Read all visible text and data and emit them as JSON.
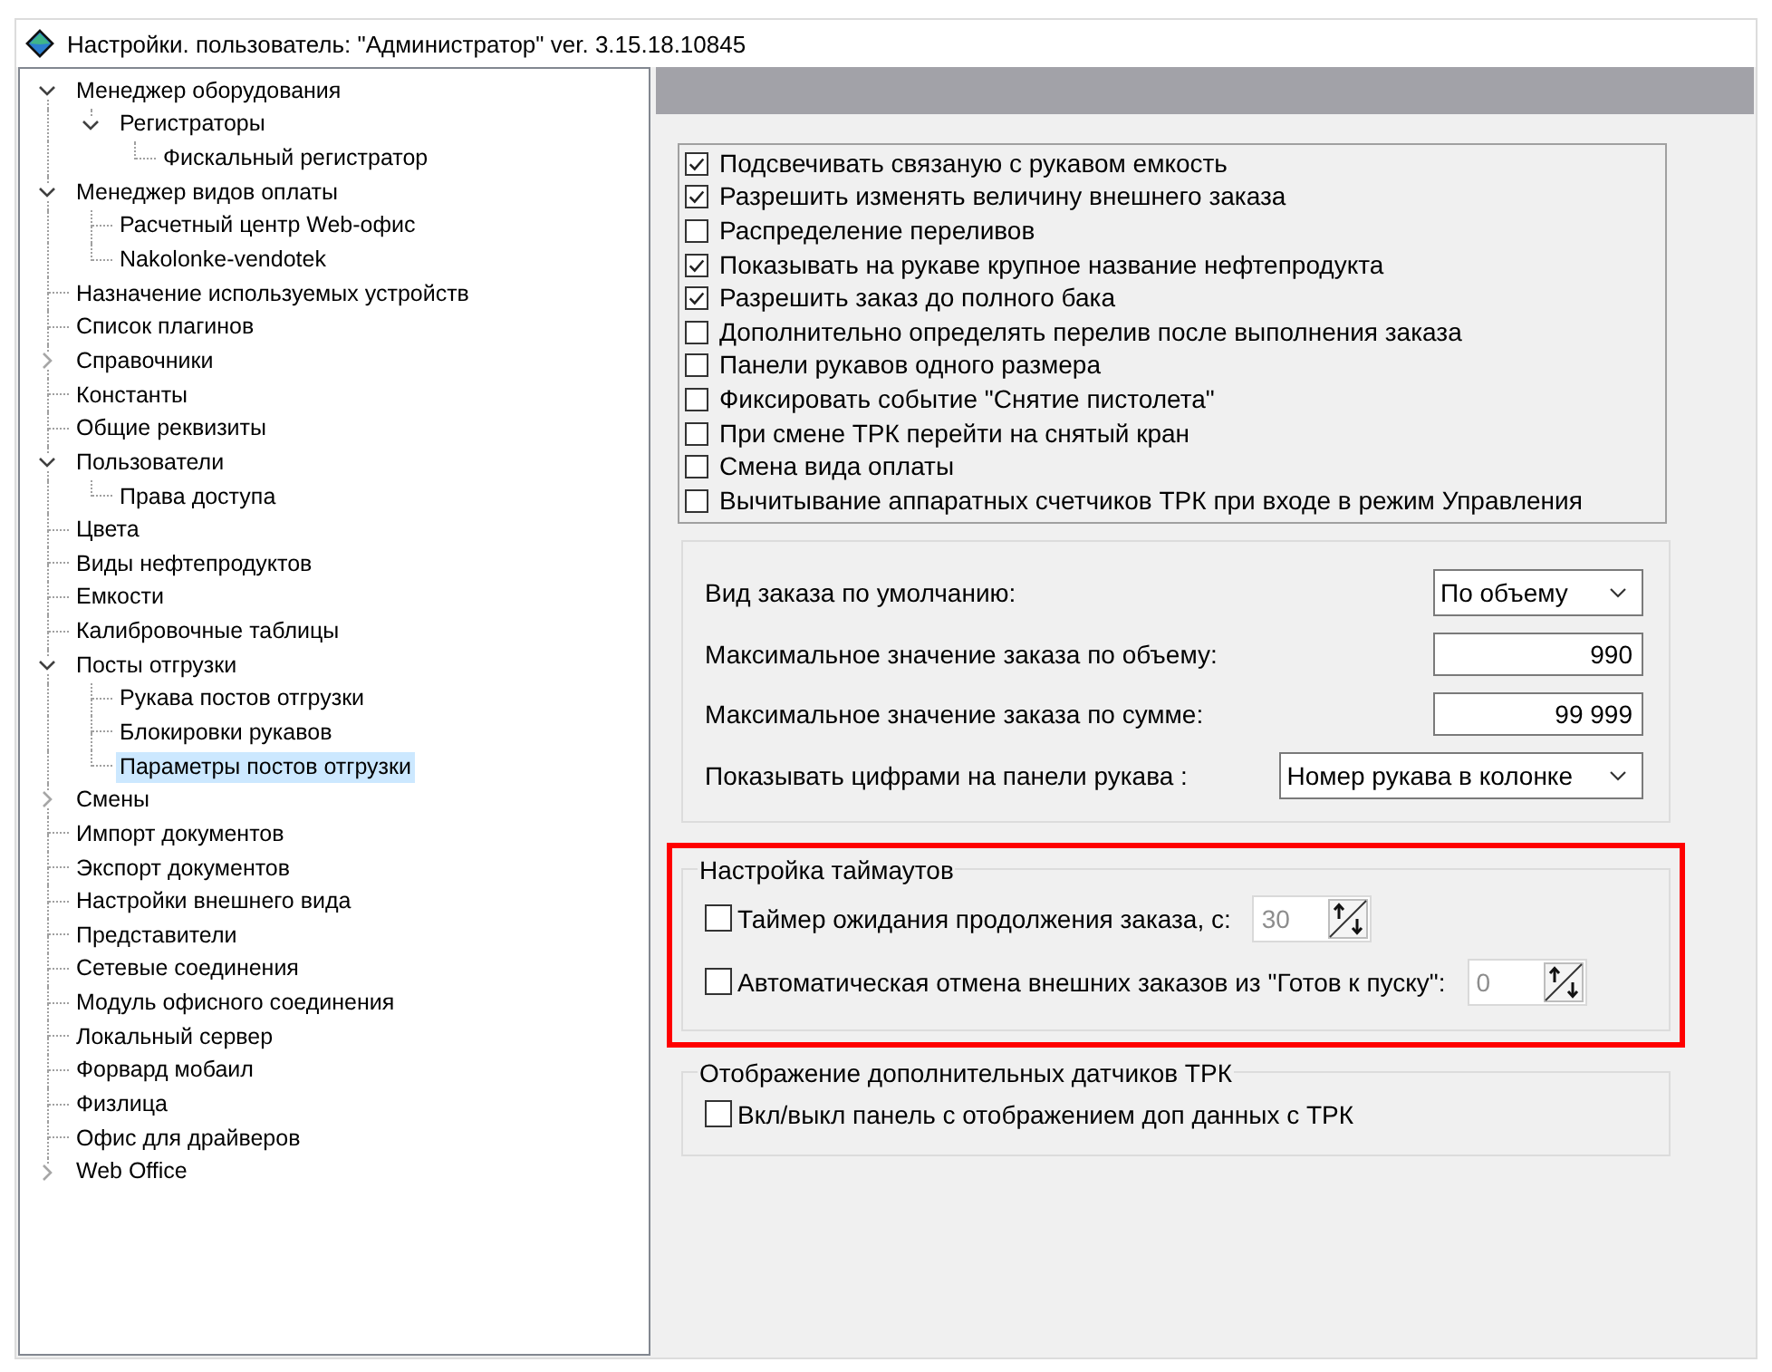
{
  "window": {
    "title": "Настройки. пользователь: \"Администратор\" ver. 3.15.18.10845"
  },
  "tree": {
    "items": [
      {
        "label": "Менеджер оборудования",
        "expanded": true,
        "selected": false,
        "children": [
          {
            "label": "Регистраторы",
            "expanded": true,
            "selected": false,
            "children": [
              {
                "label": "Фискальный регистратор",
                "selected": false
              }
            ]
          }
        ]
      },
      {
        "label": "Менеджер видов оплаты",
        "expanded": true,
        "selected": false,
        "children": [
          {
            "label": "Расчетный центр Web-офис",
            "selected": false
          },
          {
            "label": "Nakolonke-vendotek",
            "selected": false
          }
        ]
      },
      {
        "label": "Назначение используемых устройств",
        "selected": false
      },
      {
        "label": "Список плагинов",
        "selected": false
      },
      {
        "label": "Справочники",
        "expanded": false,
        "selected": false
      },
      {
        "label": "Константы",
        "selected": false
      },
      {
        "label": "Общие реквизиты",
        "selected": false
      },
      {
        "label": "Пользователи",
        "expanded": true,
        "selected": false,
        "children": [
          {
            "label": "Права доступа",
            "selected": false
          }
        ]
      },
      {
        "label": "Цвета",
        "selected": false
      },
      {
        "label": "Виды нефтепродуктов",
        "selected": false
      },
      {
        "label": "Емкости",
        "selected": false
      },
      {
        "label": "Калибровочные таблицы",
        "selected": false
      },
      {
        "label": "Посты отгрузки",
        "expanded": true,
        "selected": false,
        "children": [
          {
            "label": "Рукава постов отгрузки",
            "selected": false
          },
          {
            "label": "Блокировки рукавов",
            "selected": false
          },
          {
            "label": "Параметры постов отгрузки",
            "selected": true
          }
        ]
      },
      {
        "label": "Смены",
        "expanded": false,
        "selected": false
      },
      {
        "label": "Импорт документов",
        "selected": false
      },
      {
        "label": "Экспорт документов",
        "selected": false
      },
      {
        "label": "Настройки внешнего вида",
        "selected": false
      },
      {
        "label": "Представители",
        "selected": false
      },
      {
        "label": "Сетевые соединения",
        "selected": false
      },
      {
        "label": "Модуль офисного соединения",
        "selected": false
      },
      {
        "label": "Локальный сервер",
        "selected": false
      },
      {
        "label": "Форвард мобаил",
        "selected": false
      },
      {
        "label": "Физлица",
        "selected": false
      },
      {
        "label": "Офис для драйверов",
        "selected": false
      },
      {
        "label": "Web Office",
        "expanded": false,
        "selected": false
      }
    ]
  },
  "options": [
    {
      "label": "Подсвечивать связаную с рукавом емкость",
      "checked": true
    },
    {
      "label": "Разрешить изменять величину внешнего заказа",
      "checked": true
    },
    {
      "label": "Распределение переливов",
      "checked": false
    },
    {
      "label": "Показывать на рукаве крупное название нефтепродукта",
      "checked": true
    },
    {
      "label": "Разрешить заказ до полного бака",
      "checked": true
    },
    {
      "label": "Дополнительно определять перелив после выполнения заказа",
      "checked": false
    },
    {
      "label": "Панели рукавов одного размера",
      "checked": false
    },
    {
      "label": "Фиксировать событие \"Снятие пистолета\"",
      "checked": false
    },
    {
      "label": "При смене ТРК перейти на снятый кран",
      "checked": false
    },
    {
      "label": "Смена вида оплаты",
      "checked": false
    },
    {
      "label": "Вычитывание аппаратных счетчиков ТРК при входе в режим Управления",
      "checked": false
    }
  ],
  "order_settings": {
    "fields": [
      {
        "kind": "dropdown",
        "label": "Вид заказа по умолчанию:",
        "value": "По объему"
      },
      {
        "kind": "number",
        "label": "Максимальное значение заказа по объему:",
        "value": "990"
      },
      {
        "kind": "number",
        "label": "Максимальное значение заказа по сумме:",
        "value": "99 999"
      },
      {
        "kind": "dropdown",
        "label": "Показывать цифрами на панели рукава :",
        "value": "Номер рукава в колонке"
      }
    ]
  },
  "timeouts": {
    "title": "Настройка таймаутов",
    "highlighted": true,
    "rows": [
      {
        "label": "Таймер ожидания продолжения заказа, с:",
        "checked": false,
        "value": "30",
        "disabled": true
      },
      {
        "label": "Автоматическая отмена внешних заказов из \"Готов к пуску\":",
        "checked": false,
        "value": "0",
        "disabled": true
      }
    ]
  },
  "sensors": {
    "title": "Отображение дополнительных датчиков ТРК",
    "rows": [
      {
        "label": "Вкл/выкл панель с отображением доп данных с ТРК",
        "checked": false
      }
    ]
  }
}
